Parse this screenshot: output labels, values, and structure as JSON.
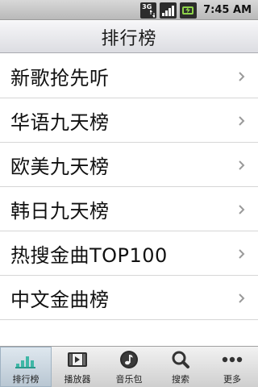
{
  "status_bar": {
    "network_badge": "3G",
    "clock": "7:45 AM",
    "icons": [
      "3g-data-icon",
      "signal-icon",
      "battery-charging-icon"
    ]
  },
  "header": {
    "title": "排行榜"
  },
  "list": {
    "items": [
      {
        "label": "新歌抢先听"
      },
      {
        "label": "华语九天榜"
      },
      {
        "label": "欧美九天榜"
      },
      {
        "label": "韩日九天榜"
      },
      {
        "label": "热搜金曲TOP100"
      },
      {
        "label": "中文金曲榜"
      }
    ]
  },
  "tab_bar": {
    "active": "排行榜",
    "tabs": [
      {
        "label": "排行榜",
        "icon": "chart-bars-icon"
      },
      {
        "label": "播放器",
        "icon": "player-icon"
      },
      {
        "label": "音乐包",
        "icon": "music-note-icon"
      },
      {
        "label": "搜索",
        "icon": "search-icon"
      },
      {
        "label": "更多",
        "icon": "more-dots-icon"
      }
    ]
  },
  "colors": {
    "status_bar_bg": "#c8c8c8",
    "battery_accent": "#8ed34a",
    "active_tab_bg": "#c9d5df"
  }
}
